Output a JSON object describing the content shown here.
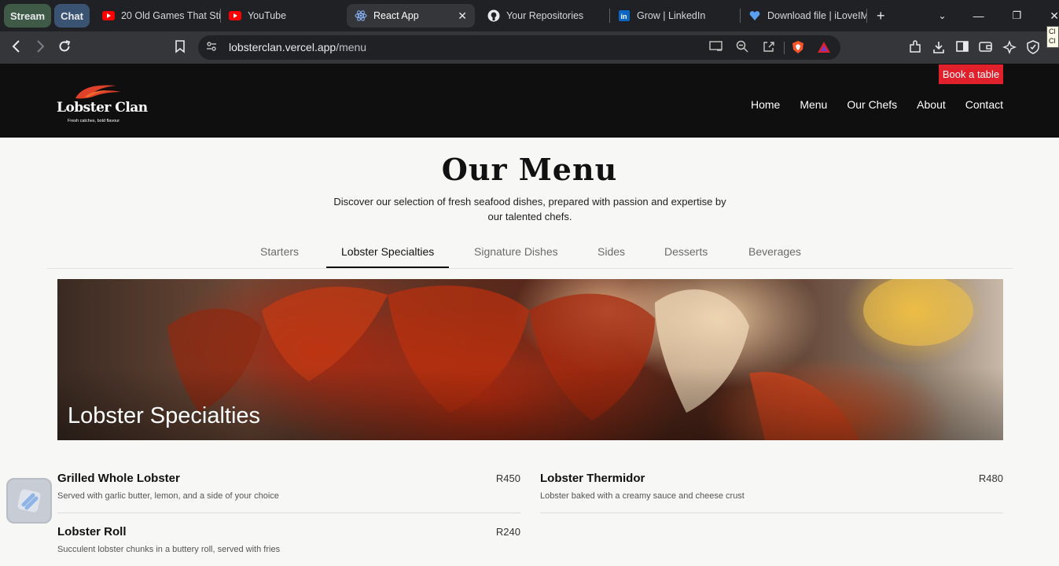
{
  "browser": {
    "groups": [
      {
        "label": "Stream",
        "color": "#3f5a47"
      },
      {
        "label": "Chat",
        "color": "#3b5372"
      }
    ],
    "tabs": [
      {
        "title": "20 Old Games That Sti",
        "icon": "youtube-icon",
        "active": false
      },
      {
        "title": "YouTube",
        "icon": "youtube-icon",
        "active": false
      },
      {
        "title": "React App",
        "icon": "react-icon",
        "active": true
      },
      {
        "title": "Your Repositories",
        "icon": "github-icon",
        "active": false
      },
      {
        "title": "Grow | LinkedIn",
        "icon": "linkedin-icon",
        "active": false
      },
      {
        "title": "Download file | iLoveIM",
        "icon": "heart-icon",
        "active": false
      }
    ],
    "url_host": "lobsterclan.vercel.app",
    "url_path": "/menu",
    "tooltip": "Cl Cl"
  },
  "site": {
    "logo_title": "Lobster Clan",
    "logo_tagline": "Fresh catches, bold flavour",
    "book_button": "Book a table",
    "nav": [
      "Home",
      "Menu",
      "Our Chefs",
      "About",
      "Contact"
    ],
    "accent_color": "#e0212b"
  },
  "menu": {
    "title": "Our Menu",
    "intro": "Discover our selection of fresh seafood dishes, prepared with passion and expertise by our talented chefs.",
    "tabs": [
      "Starters",
      "Lobster Specialties",
      "Signature Dishes",
      "Sides",
      "Desserts",
      "Beverages"
    ],
    "active_tab": "Lobster Specialties",
    "hero_title": "Lobster Specialties",
    "items": [
      {
        "name": "Grilled Whole Lobster",
        "price": "R450",
        "desc": "Served with garlic butter, lemon, and a side of your choice"
      },
      {
        "name": "Lobster Thermidor",
        "price": "R480",
        "desc": "Lobster baked with a creamy sauce and cheese crust"
      },
      {
        "name": "Lobster Roll",
        "price": "R240",
        "desc": "Succulent lobster chunks in a buttery roll, served with fries"
      }
    ]
  }
}
